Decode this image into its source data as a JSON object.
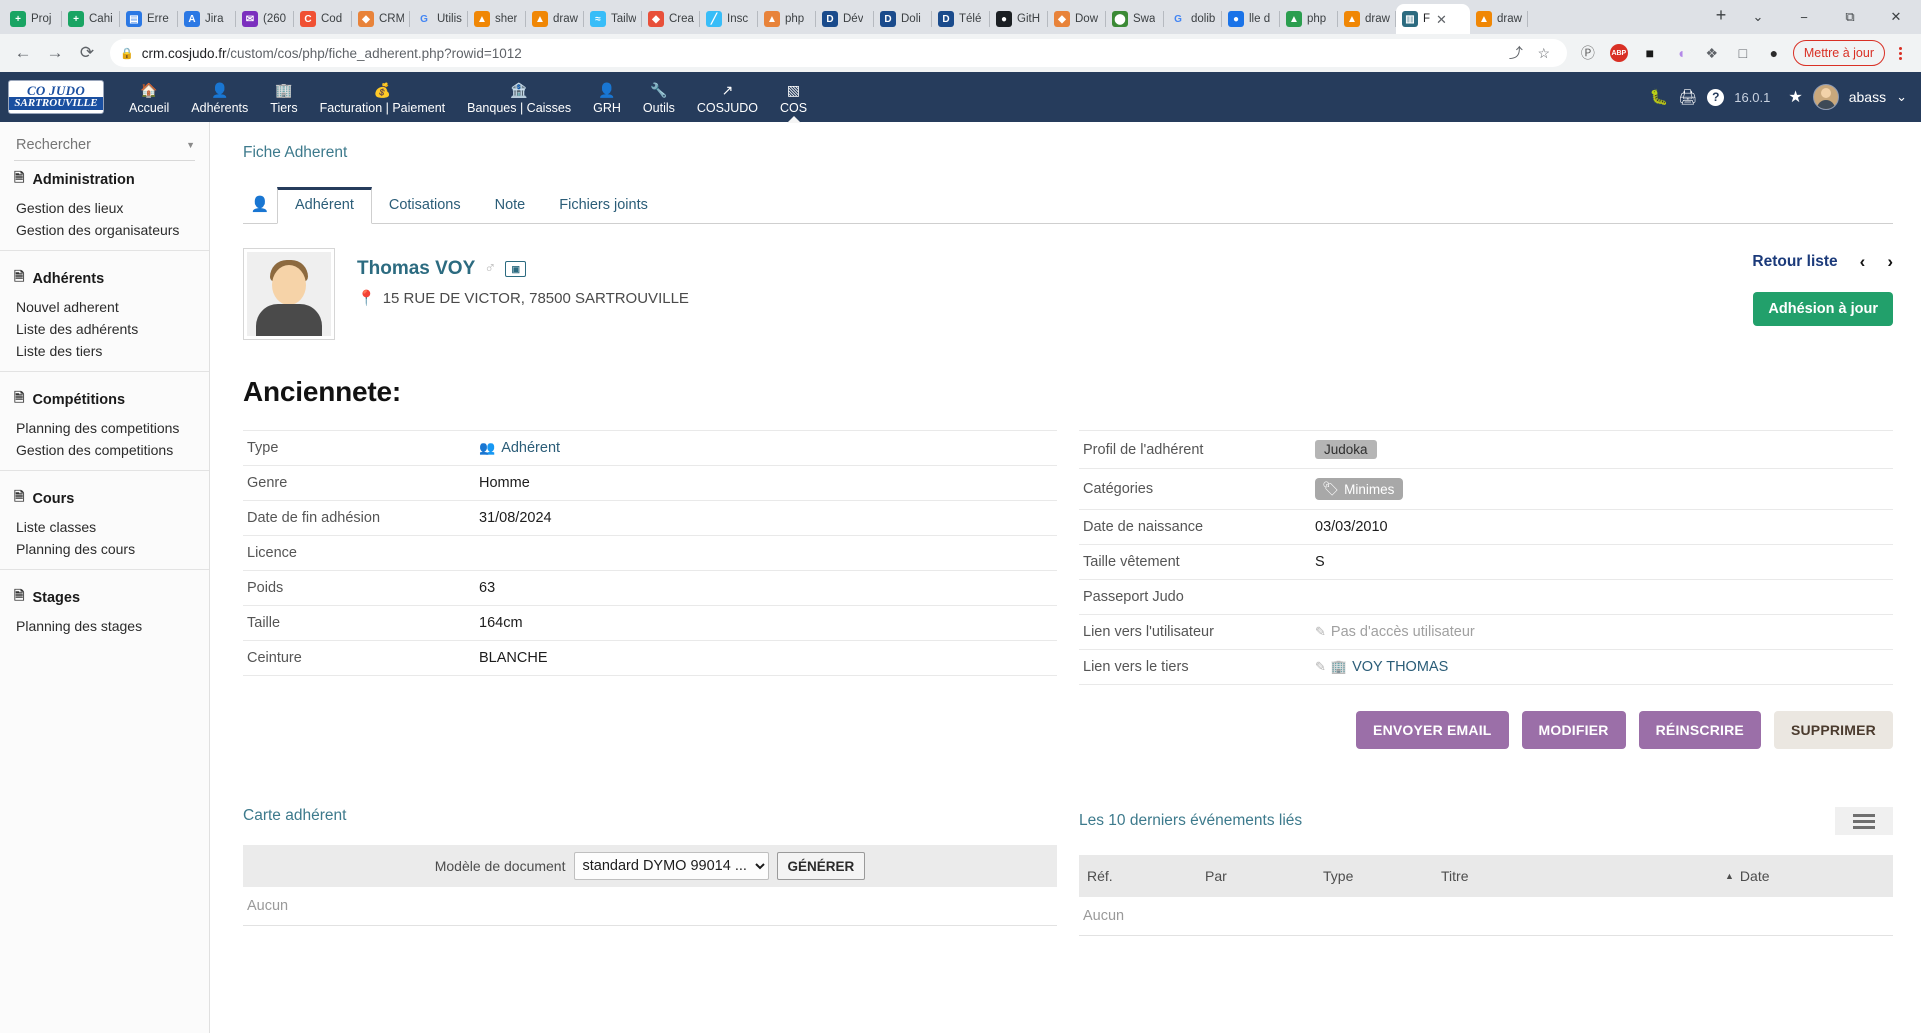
{
  "browser": {
    "tabs": [
      {
        "label": "Proj",
        "fav": "+",
        "color": "#19a463"
      },
      {
        "label": "Cahi",
        "fav": "+",
        "color": "#19a463"
      },
      {
        "label": "Erre",
        "fav": "▤",
        "color": "#2b78e4"
      },
      {
        "label": "Jira",
        "fav": "A",
        "color": "#2b78e4"
      },
      {
        "label": "(260",
        "fav": "✉",
        "color": "#7b2fbe"
      },
      {
        "label": "Cod",
        "fav": "C",
        "color": "#f05033"
      },
      {
        "label": "CRM",
        "fav": "◆",
        "color": "#e8833a"
      },
      {
        "label": "Utilis",
        "fav": "G",
        "color": "#ffffff"
      },
      {
        "label": "sher",
        "fav": "▲",
        "color": "#f08705"
      },
      {
        "label": "draw",
        "fav": "▲",
        "color": "#f08705"
      },
      {
        "label": "Tailw",
        "fav": "≈",
        "color": "#38bdf8"
      },
      {
        "label": "Crea",
        "fav": "◆",
        "color": "#e8503a"
      },
      {
        "label": "Insc",
        "fav": "╱",
        "color": "#38bdf8"
      },
      {
        "label": "php",
        "fav": "▲",
        "color": "#e8833a"
      },
      {
        "label": "Dév",
        "fav": "D",
        "color": "#1a4b8c"
      },
      {
        "label": "Doli",
        "fav": "D",
        "color": "#1a4b8c"
      },
      {
        "label": "Télé",
        "fav": "D",
        "color": "#1a4b8c"
      },
      {
        "label": "GitH",
        "fav": "●",
        "color": "#1b1f23"
      },
      {
        "label": "Dow",
        "fav": "◆",
        "color": "#e8833a"
      },
      {
        "label": "Swa",
        "fav": "⬤",
        "color": "#3b8a35"
      },
      {
        "label": "dolib",
        "fav": "G",
        "color": "#ffffff"
      },
      {
        "label": "lle d",
        "fav": "●",
        "color": "#1a73e8"
      },
      {
        "label": "php",
        "fav": "▲",
        "color": "#2b9e4f"
      },
      {
        "label": "draw",
        "fav": "▲",
        "color": "#f08705"
      },
      {
        "label": "F",
        "fav": "▥",
        "color": "#2c6b80",
        "active": true
      },
      {
        "label": "draw",
        "fav": "▲",
        "color": "#f08705"
      }
    ],
    "new_tab_label": "+",
    "window_controls": {
      "dropdown": "⌄",
      "minimize": "−",
      "maximize": "⧉",
      "close": "✕"
    },
    "back_label": "←",
    "forward_label": "→",
    "reload_label": "⟳",
    "lock_label": "🔒",
    "url_domain": "crm.cosjudo.fr",
    "url_path": "/custom/cos/php/fiche_adherent.php?rowid=1012",
    "toolbar_icons": [
      {
        "name": "share-icon",
        "glyph": "⤴"
      },
      {
        "name": "bookmark-star-icon",
        "glyph": "☆"
      }
    ],
    "extensions": [
      {
        "name": "pocket-icon",
        "glyph": "Ⓟ",
        "color": "#6b6b6b"
      },
      {
        "name": "adblock-icon",
        "glyph": "ABP",
        "color": "#d93025"
      },
      {
        "name": "keeper-icon",
        "glyph": "■",
        "color": "#1a1a1a"
      },
      {
        "name": "grammar-icon",
        "glyph": "◖",
        "color": "#b388e8"
      },
      {
        "name": "puzzle-extensions-icon",
        "glyph": "❖",
        "color": "#5f6368"
      },
      {
        "name": "sidepanel-icon",
        "glyph": "□",
        "color": "#5f6368"
      },
      {
        "name": "profile-avatar-icon",
        "glyph": "●",
        "color": "#2b2b2b"
      }
    ],
    "update_label": "Mettre à jour"
  },
  "app_header": {
    "logo_line1": "CO   JUDO",
    "logo_line2": "SARTROUVILLE",
    "menu": [
      {
        "label": "Accueil",
        "icon": "🏠",
        "icon_name": "home-icon"
      },
      {
        "label": "Adhérents",
        "icon": "👤",
        "icon_name": "members-icon"
      },
      {
        "label": "Tiers",
        "icon": "🏢",
        "icon_name": "thirdparty-icon"
      },
      {
        "label": "Facturation | Paiement",
        "icon": "💰",
        "icon_name": "billing-icon"
      },
      {
        "label": "Banques | Caisses",
        "icon": "🏦",
        "icon_name": "bank-icon"
      },
      {
        "label": "GRH",
        "icon": "👤",
        "icon_name": "hr-icon"
      },
      {
        "label": "Outils",
        "icon": "🔧",
        "icon_name": "tools-icon"
      },
      {
        "label": "COSJUDO",
        "icon": "↗",
        "icon_name": "cosjudo-icon"
      },
      {
        "label": "COS",
        "icon": "▧",
        "icon_name": "cos-icon",
        "active": true
      }
    ],
    "right": {
      "bug_icon": "🐛",
      "print_icon": "🖨",
      "help_icon": "?",
      "version": "16.0.1",
      "star_icon": "★",
      "user": "abass",
      "chevron": "⌄"
    }
  },
  "sidebar": {
    "search_placeholder": "Rechercher",
    "search_value": "",
    "groups": [
      {
        "title": "Administration",
        "links": [
          "Gestion des lieux",
          "Gestion des organisateurs"
        ]
      },
      {
        "title": "Adhérents",
        "links": [
          "Nouvel adherent",
          "Liste des adhérents",
          "Liste des tiers"
        ]
      },
      {
        "title": "Compétitions",
        "links": [
          "Planning des competitions",
          "Gestion des competitions"
        ]
      },
      {
        "title": "Cours",
        "links": [
          "Liste classes",
          "Planning des cours"
        ]
      },
      {
        "title": "Stages",
        "links": [
          "Planning des stages"
        ]
      }
    ]
  },
  "main": {
    "breadcrumb": "Fiche Adherent",
    "tabs": [
      {
        "label": "Adhérent",
        "active": true
      },
      {
        "label": "Cotisations",
        "active": false
      },
      {
        "label": "Note",
        "active": false
      },
      {
        "label": "Fichiers joints",
        "active": false
      }
    ],
    "person": {
      "name": "Thomas VOY",
      "gender_symbol": "♂",
      "address": "15 RUE DE VICTOR, 78500 SARTROUVILLE"
    },
    "retour_liste": "Retour liste",
    "prev_arrow": "‹",
    "next_arrow": "›",
    "adhesion_button": "Adhésion à jour",
    "section_title": "Anciennete:",
    "left_table": [
      {
        "label": "Type",
        "value": "Adhérent",
        "style": "link-group"
      },
      {
        "label": "Genre",
        "value": "Homme",
        "style": "plain"
      },
      {
        "label": "Date de fin adhésion",
        "value": "31/08/2024",
        "style": "plain"
      },
      {
        "label": "Licence",
        "value": "",
        "style": "plain"
      },
      {
        "label": "Poids",
        "value": "63",
        "style": "plain"
      },
      {
        "label": "Taille",
        "value": "164cm",
        "style": "plain"
      },
      {
        "label": "Ceinture",
        "value": "BLANCHE",
        "style": "plain"
      }
    ],
    "right_table": [
      {
        "label": "Profil de l'adhérent",
        "value": "Judoka",
        "style": "chip"
      },
      {
        "label": "Catégories",
        "value": "Minimes",
        "style": "chip-tag"
      },
      {
        "label": "Date de naissance",
        "value": "03/03/2010",
        "style": "plain"
      },
      {
        "label": "Taille vêtement",
        "value": "S",
        "style": "plain"
      },
      {
        "label": "Passeport Judo",
        "value": "",
        "style": "plain"
      },
      {
        "label": "Lien vers l'utilisateur",
        "value": "Pas d'accès utilisateur",
        "style": "pencil-muted"
      },
      {
        "label": "Lien vers le tiers",
        "value": "VOY THOMAS",
        "style": "pencil-link"
      }
    ],
    "actions": [
      {
        "label": "ENVOYER EMAIL",
        "style": "purple"
      },
      {
        "label": "MODIFIER",
        "style": "purple"
      },
      {
        "label": "RÉINSCRIRE",
        "style": "purple"
      },
      {
        "label": "SUPPRIMER",
        "style": "grey"
      }
    ],
    "card_section": {
      "title": "Carte adhérent",
      "doc_label": "Modèle de document",
      "select_value": "standard DYMO 99014 ...",
      "generate_button": "GÉNÉRER",
      "empty_text": "Aucun"
    },
    "events_section": {
      "title": "Les 10 derniers événements liés",
      "columns": [
        "Réf.",
        "Par",
        "Type",
        "Titre",
        "Date"
      ],
      "sort_caret": "▲",
      "empty_text": "Aucun"
    }
  }
}
